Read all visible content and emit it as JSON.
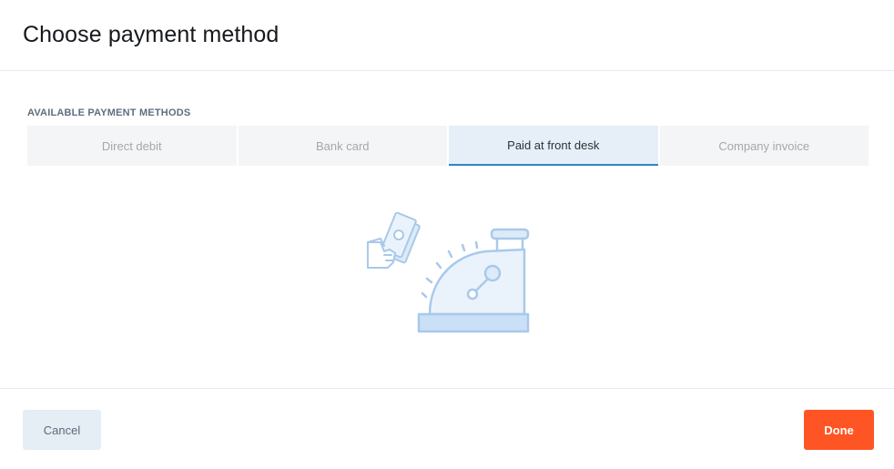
{
  "dialog": {
    "title": "Choose payment method"
  },
  "payment_methods": {
    "section_label": "AVAILABLE PAYMENT METHODS",
    "tabs": [
      {
        "label": "Direct debit",
        "active": false
      },
      {
        "label": "Bank card",
        "active": false
      },
      {
        "label": "Paid at front desk",
        "active": true
      },
      {
        "label": "Company invoice",
        "active": false
      }
    ],
    "illustration_icon": "cash-register-icon"
  },
  "footer": {
    "cancel_label": "Cancel",
    "done_label": "Done"
  },
  "colors": {
    "accent": "#2f86c7",
    "primary_button": "#ff5524",
    "secondary_button": "#e5edf5",
    "illustration_stroke": "#a9c9ea",
    "illustration_fill": "#ddebf9"
  }
}
